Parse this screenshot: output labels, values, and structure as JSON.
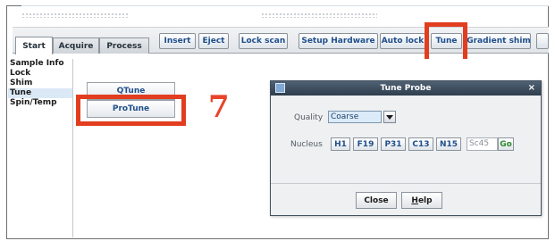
{
  "tabs": [
    {
      "label": "Start"
    },
    {
      "label": "Acquire"
    },
    {
      "label": "Process"
    }
  ],
  "toolbar": {
    "insert": "Insert",
    "eject": "Eject",
    "lock_scan": "Lock scan",
    "setup_hardware": "Setup Hardware",
    "auto_lock": "Auto lock",
    "tune": "Tune",
    "gradient_shim": "Gradient shim"
  },
  "sidebar": {
    "items": [
      {
        "label": "Sample Info"
      },
      {
        "label": "Lock"
      },
      {
        "label": "Shim"
      },
      {
        "label": "Tune",
        "selected": true
      },
      {
        "label": "Spin/Temp"
      }
    ]
  },
  "main": {
    "qtune_label": "QTune",
    "protune_label": "ProTune"
  },
  "annotation": {
    "step_number": "7",
    "highlight_color": "#e23d1f"
  },
  "dialog": {
    "title": "Tune Probe",
    "close_glyph": "×",
    "quality_label": "Quality",
    "quality_value": "Coarse",
    "nucleus_label": "Nucleus",
    "nuclei": [
      "H1",
      "F19",
      "P31",
      "C13",
      "N15"
    ],
    "custom_nucleus_value": "Sc45",
    "go_label": "Go",
    "close_button": "Close",
    "help_button_first": "H",
    "help_button_rest": "elp"
  }
}
